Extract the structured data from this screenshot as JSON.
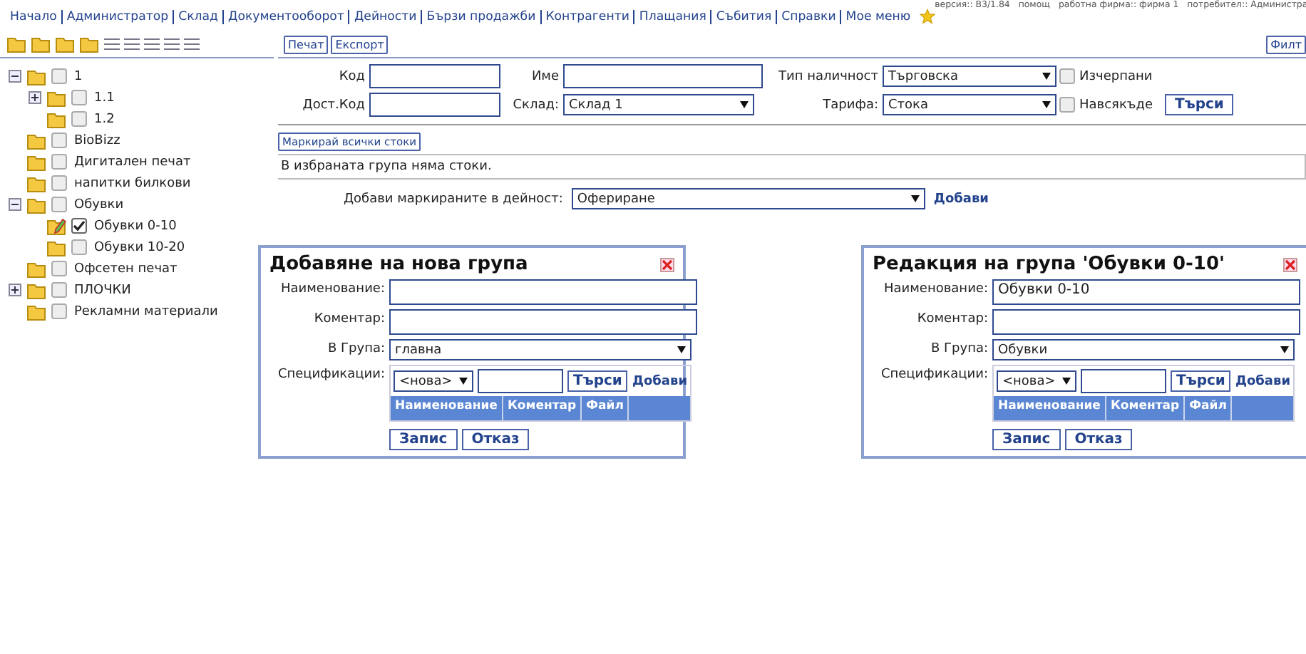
{
  "nav": {
    "items": [
      "Начало",
      "Администратор",
      "Склад",
      "Документооборот",
      "Дейности",
      "Бързи продажби",
      "Контрагенти",
      "Плащания",
      "Събития",
      "Справки",
      "Мое меню"
    ],
    "info": [
      "версия:: B3/1.84",
      "помощ",
      "работна фирма:: фирма 1",
      "потребител:: Администра"
    ]
  },
  "toolbar": {
    "buttons": [
      "Печат",
      "Експорт"
    ],
    "filter_button": "Филт"
  },
  "tree": [
    {
      "label": "1",
      "expanded": true,
      "checked": false,
      "selected": false,
      "children": [
        {
          "label": "1.1",
          "expanded": false,
          "checked": false,
          "selected": false
        },
        {
          "label": "1.2",
          "checked": false,
          "selected": false
        }
      ]
    },
    {
      "label": "BioBizz",
      "checked": false,
      "selected": false
    },
    {
      "label": "Дигитален печат",
      "checked": false,
      "selected": false
    },
    {
      "label": "напитки билкови",
      "checked": false,
      "selected": false
    },
    {
      "label": "Обувки",
      "expanded": true,
      "checked": false,
      "selected": false,
      "children": [
        {
          "label": "Обувки 0-10",
          "checked": true,
          "selected": true
        },
        {
          "label": "Обувки 10-20",
          "checked": false,
          "selected": false
        }
      ]
    },
    {
      "label": "Офсетен печат",
      "checked": false,
      "selected": false
    },
    {
      "label": "ПЛОЧКИ",
      "expanded": false,
      "checked": false,
      "selected": false
    },
    {
      "label": "Рекламни материали",
      "checked": false,
      "selected": false
    }
  ],
  "filters": {
    "code_label": "Код",
    "name_label": "Име",
    "stock_type_label": "Тип наличност",
    "stock_type": "Търговска",
    "exhausted_label": "Изчерпани",
    "exhausted": false,
    "supplier_code_label": "Дост.Код",
    "warehouse_label": "Склад:",
    "warehouse": "Склад 1",
    "tariff_label": "Тарифа:",
    "tariff": "Стока",
    "everywhere_label": "Навсякъде",
    "everywhere": false,
    "search_button": "Търси"
  },
  "mark_all_button": "Маркирай всички стоки",
  "message": "В избраната група няма стоки.",
  "add_to_activity": {
    "label": "Добави маркираните в дейност:",
    "value": "Офериране",
    "link": "Добави"
  },
  "dialogs": [
    {
      "title": "Добавяне на нова група",
      "name_label": "Наименование:",
      "comment_label": "Коментар:",
      "group_label": "В Група:",
      "group_value": "главна",
      "spec_label": "Спецификации:",
      "spec_select": "<нова>",
      "search_button": "Търси",
      "add_link": "Добави",
      "columns": [
        "Наименование",
        "Коментар",
        "Файл"
      ],
      "buttons": [
        "Запис",
        "Отказ"
      ]
    },
    {
      "title": "Редакция на група 'Обувки 0-10'",
      "name_label": "Наименование:",
      "name_value": "Обувки 0-10",
      "comment_label": "Коментар:",
      "group_label": "В Група:",
      "group_value": "Обувки",
      "spec_label": "Спецификации:",
      "spec_select": "<нова>",
      "search_button": "Търси",
      "add_link": "Добави",
      "columns": [
        "Наименование",
        "Коментар",
        "Файл"
      ],
      "buttons": [
        "Запис",
        "Отказ"
      ]
    }
  ]
}
